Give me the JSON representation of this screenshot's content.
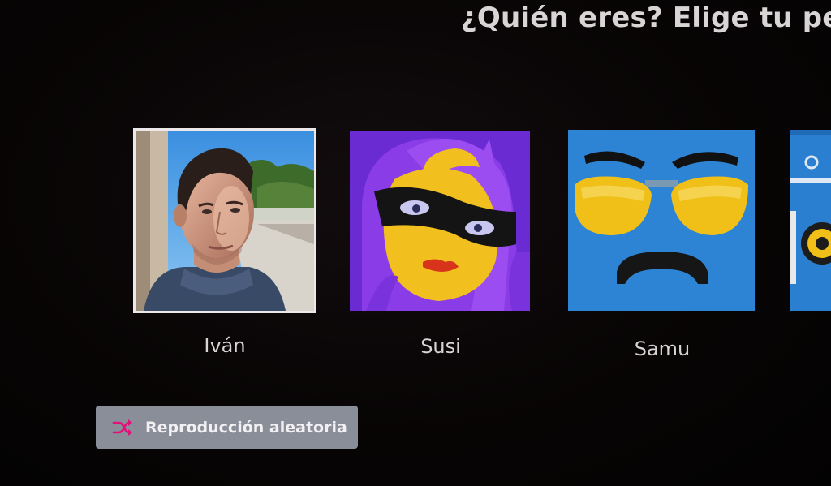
{
  "header": {
    "title": "¿Quién eres? Elige tu perfil"
  },
  "profiles": [
    {
      "name": "Iván",
      "selected": true,
      "avatar": "photo-avatar"
    },
    {
      "name": "Susi",
      "selected": false,
      "avatar": "masked-woman-avatar"
    },
    {
      "name": "Samu",
      "selected": false,
      "avatar": "sunglasses-mustache-avatar"
    },
    {
      "name": "",
      "selected": false,
      "avatar": "robot-avatar"
    }
  ],
  "shuffle": {
    "label": "Reproducción aleatoria",
    "icon": "shuffle-icon",
    "icon_color": "#e2107a"
  },
  "colors": {
    "background": "#050303",
    "selection_border": "#ece8ea",
    "button_bg": "#8a8e99"
  }
}
